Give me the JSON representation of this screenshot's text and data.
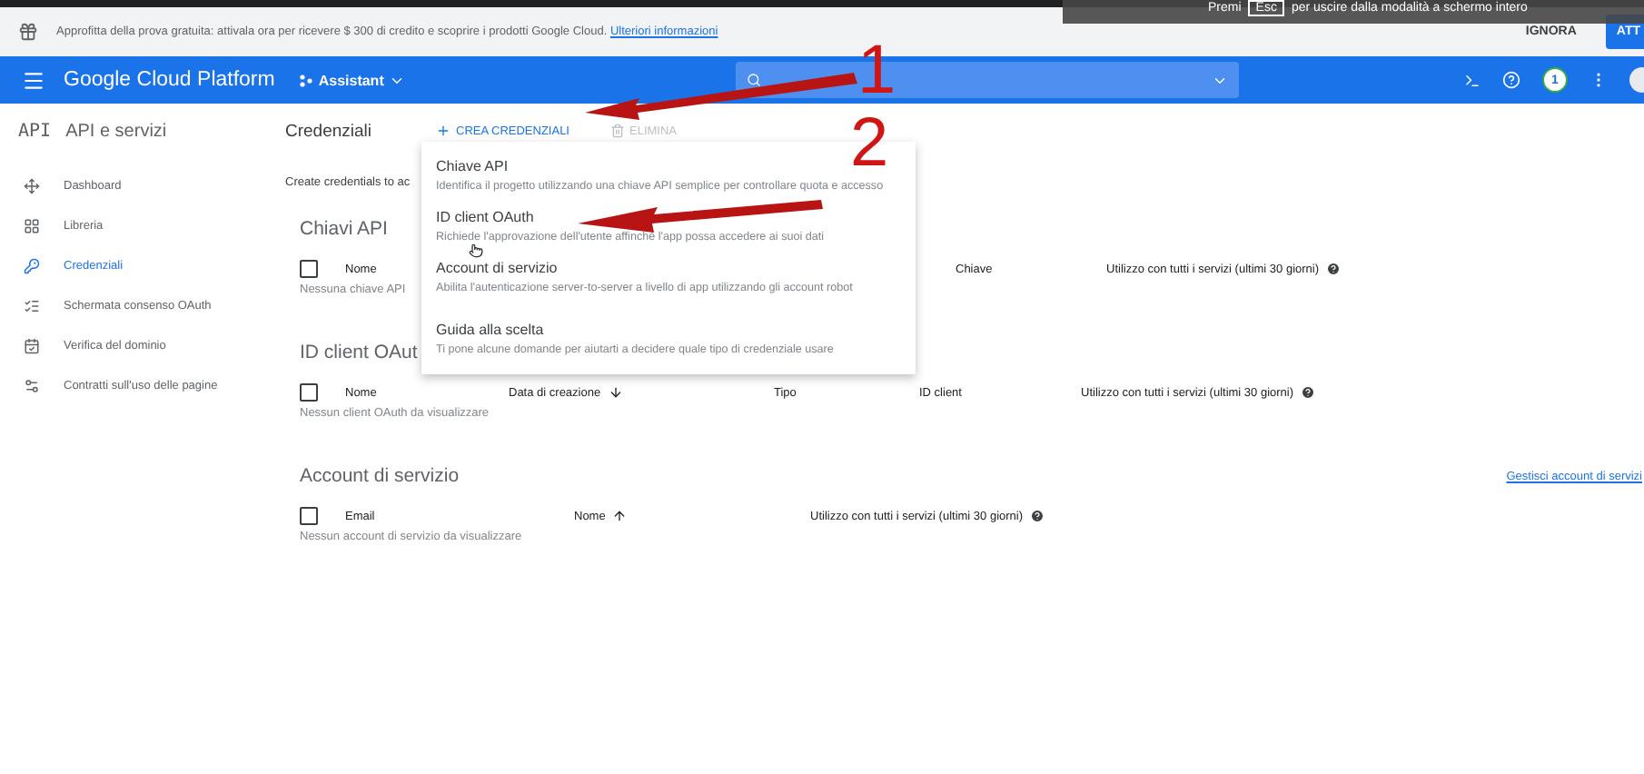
{
  "fullscreen_notice": {
    "before": "Premi",
    "key": "Esc",
    "after": "per uscire dalla modalità a schermo intero"
  },
  "promo_bar": {
    "text": "Approfitta della prova gratuita: attivala ora per ricevere $ 300 di credito e scoprire i prodotti Google Cloud.",
    "link": "Ulteriori informazioni",
    "dismiss": "IGNORA",
    "activate": "ATT"
  },
  "app_bar": {
    "title": "Google Cloud Platform",
    "project": "Assistant",
    "notification_count": "1"
  },
  "sidebar": {
    "logo": "API",
    "title": "API e servizi",
    "items": [
      {
        "label": "Dashboard",
        "selected": false
      },
      {
        "label": "Libreria",
        "selected": false
      },
      {
        "label": "Credenziali",
        "selected": true
      },
      {
        "label": "Schermata consenso OAuth",
        "selected": false
      },
      {
        "label": "Verifica del dominio",
        "selected": false
      },
      {
        "label": "Contratti sull'uso delle pagine",
        "selected": false
      }
    ]
  },
  "page": {
    "title": "Credenziali",
    "actions": [
      {
        "label": "CREA CREDENZIALI",
        "disabled": false
      },
      {
        "label": "ELIMINA",
        "disabled": true
      }
    ],
    "intro": "Create credentials to ac"
  },
  "sections": [
    {
      "title": "Chiavi API",
      "checked": false,
      "columns": [
        {
          "label": "Nome"
        },
        {
          "label": "Chiave"
        },
        {
          "label": "Utilizzo con tutti i servizi (ultimi 30 giorni)",
          "help": true
        }
      ],
      "empty": "Nessuna chiave API"
    },
    {
      "title": "ID client OAut",
      "checked": false,
      "columns": [
        {
          "label": "Nome"
        },
        {
          "label": "Data di creazione",
          "sort_ascending": false
        },
        {
          "label": "Tipo"
        },
        {
          "label": "ID client"
        },
        {
          "label": "Utilizzo con tutti i servizi (ultimi 30 giorni)",
          "help": true
        }
      ],
      "empty": "Nessun client OAuth da visualizzare"
    },
    {
      "title": "Account di servizio",
      "checked": false,
      "link": "Gestisci account di servizi",
      "columns": [
        {
          "label": "Email"
        },
        {
          "label": "Nome",
          "sort_ascending": true
        },
        {
          "label": "Utilizzo con tutti i servizi (ultimi 30 giorni)",
          "help": true
        }
      ],
      "empty": "Nessun account di servizio da visualizzare"
    }
  ],
  "menu": {
    "items": [
      {
        "title": "Chiave API",
        "description": "Identifica il progetto utilizzando una chiave API semplice per controllare quota e accesso"
      },
      {
        "title": "ID client OAuth",
        "description": "Richiede l'approvazione dell'utente affinché l'app possa accedere ai suoi dati"
      },
      {
        "title": "Account di servizio",
        "description": "Abilita l'autenticazione server-to-server a livello di app utilizzando gli account robot"
      },
      {
        "title": "Guida alla scelta",
        "description": "Ti pone alcune domande per aiutarti a decidere quale tipo di credenziale usare"
      }
    ]
  },
  "annotations": [
    {
      "label": "1"
    },
    {
      "label": "2"
    }
  ]
}
